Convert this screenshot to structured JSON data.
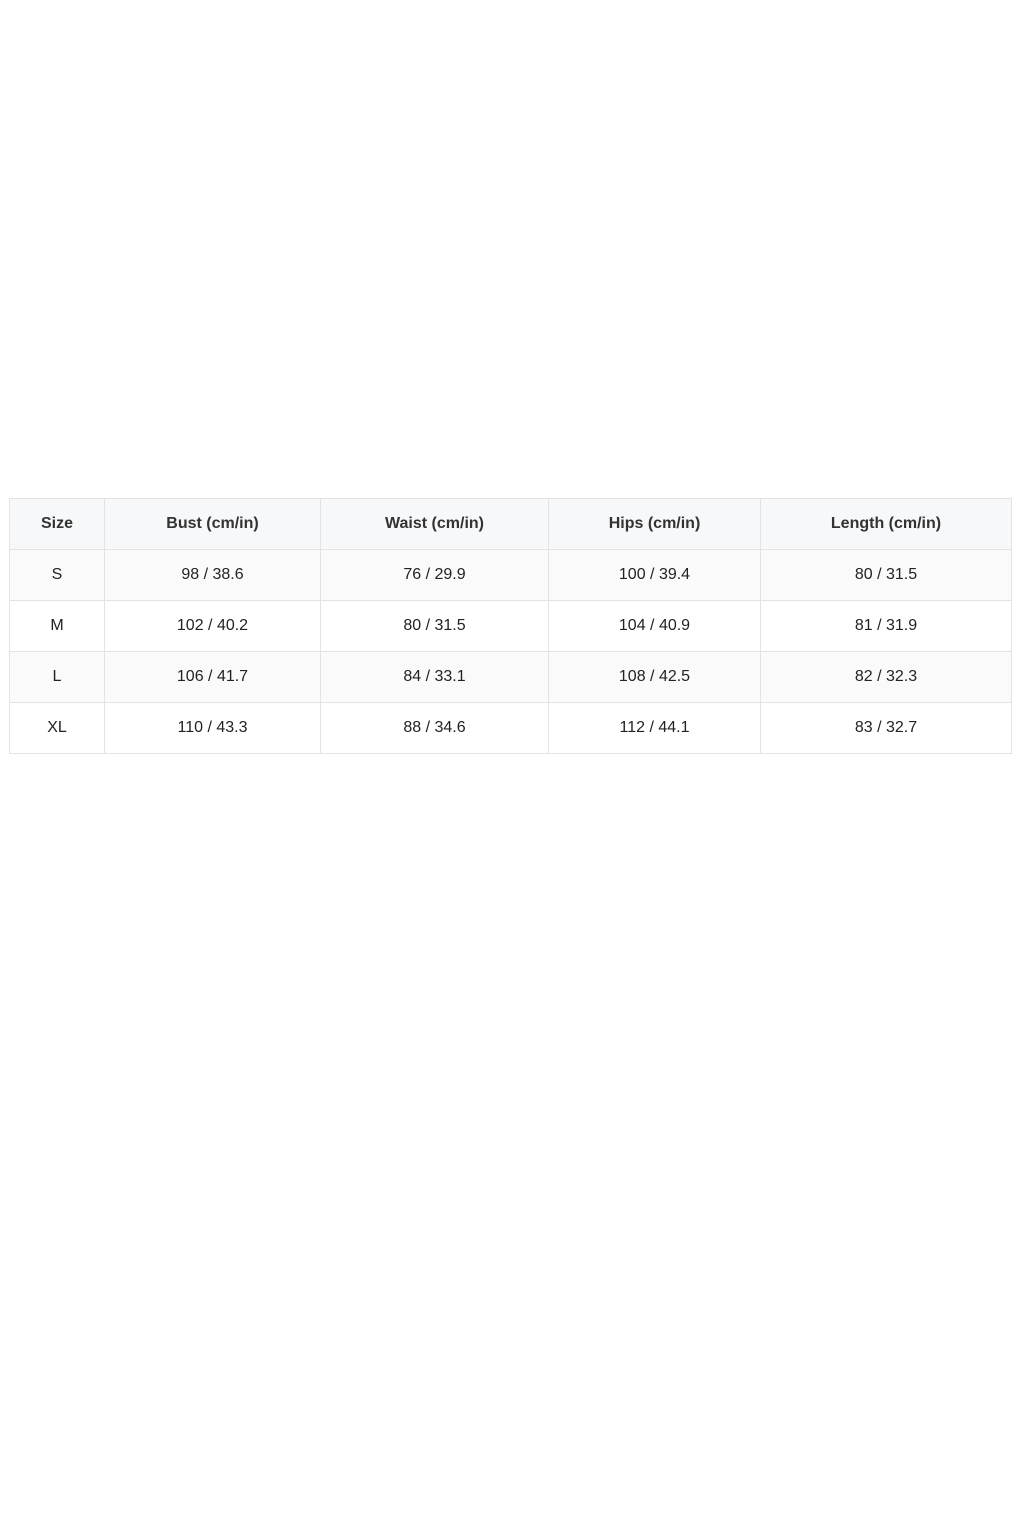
{
  "size_chart": {
    "headers": [
      "Size",
      "Bust (cm/in)",
      "Waist (cm/in)",
      "Hips (cm/in)",
      "Length (cm/in)"
    ],
    "rows": [
      [
        "S",
        "98 / 38.6",
        "76 / 29.9",
        "100 / 39.4",
        "80 / 31.5"
      ],
      [
        "M",
        "102 / 40.2",
        "80 / 31.5",
        "104 / 40.9",
        "81 / 31.9"
      ],
      [
        "L",
        "106 / 41.7",
        "84 / 33.1",
        "108 / 42.5",
        "82 / 32.3"
      ],
      [
        "XL",
        "110 / 43.3",
        "88 / 34.6",
        "112 / 44.1",
        "83 / 32.7"
      ]
    ]
  },
  "colors": {
    "border": "#e3e3e3",
    "header_background": "#f7f8f9",
    "text": "#222222"
  }
}
